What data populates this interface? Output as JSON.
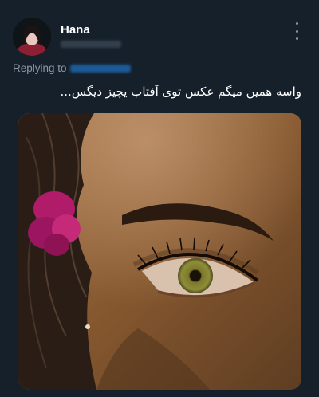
{
  "tweet": {
    "author_name": "Hana",
    "replying_to_label": "Replying to",
    "text": "واسه همین میگم عکس توی آفتاب یچیز دیگس..."
  },
  "icons": {
    "more": "more-vertical-icon"
  },
  "colors": {
    "background": "#15202b",
    "secondary_text": "#8b98a5",
    "link": "#1d9bf0"
  }
}
